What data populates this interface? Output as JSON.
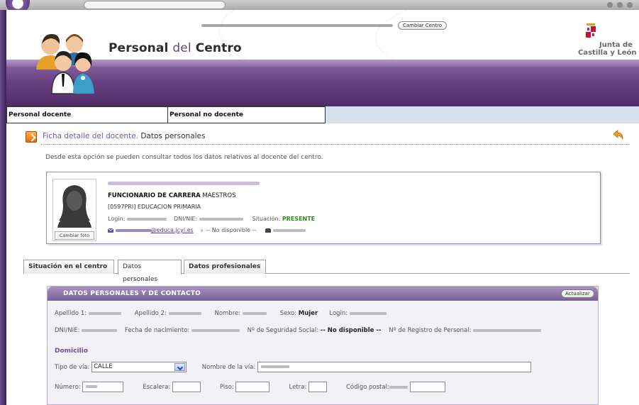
{
  "header": {
    "title_part1": "Personal",
    "title_part2": "del",
    "title_part3": "Centro",
    "change_center_label": "Cambiar Centro",
    "logo_line1": "Junta de",
    "logo_line2": "Castilla y León"
  },
  "main_nav": {
    "tabs": [
      {
        "label": "Personal docente"
      },
      {
        "label": "Personal no docente"
      }
    ]
  },
  "section": {
    "title": "Ficha detalle del docente.",
    "subtitle": "Datos personales",
    "description": "Desde esta opción se pueden consultar todos los datos relativos al docente del centro."
  },
  "teacher_card": {
    "change_photo_label": "Cambiar foto",
    "category": "FUNCIONARIO DE CARRERA",
    "body": "MAESTROS",
    "specialty": "[0597PRI] EDUCACION PRIMARIA",
    "login_label": "Login:",
    "dni_label": "DNI/NIE:",
    "situation_label": "Situación:",
    "situation_value": "PRESENTE",
    "email_domain": "@educa.jcyl.es",
    "mobile_value": "-- No disponible --"
  },
  "sub_tabs": [
    {
      "label": "Situación en el centro"
    },
    {
      "label": "Datos personales"
    },
    {
      "label": "Datos profesionales"
    }
  ],
  "panel": {
    "title": "DATOS PERSONALES Y DE CONTACTO",
    "update_label": "Actualizar",
    "surname1_label": "Apellido 1:",
    "surname2_label": "Apellido 2:",
    "name_label": "Nombre:",
    "sex_label": "Sexo:",
    "sex_value": "Mujer",
    "login_label": "Login:",
    "dni_label": "DNI/NIE:",
    "birth_label": "Fecha de nacimiento:",
    "ss_label": "Nº de Seguridad Social:",
    "ss_value": "-- No disponible --",
    "registry_label": "Nº de Registro de Personal:",
    "address_title": "Domicilio",
    "street_type_label": "Tipo de vía:",
    "street_type_value": "CALLE",
    "street_name_label": "Nombre de la vía:",
    "number_label": "Número:",
    "stairs_label": "Escalera:",
    "floor_label": "Piso:",
    "letter_label": "Letra:",
    "postal_label": "Código postal:"
  },
  "colors": {
    "brand_purple": "#6a4283",
    "present_green": "#2f8a1d",
    "accent_orange": "#e56d06"
  }
}
